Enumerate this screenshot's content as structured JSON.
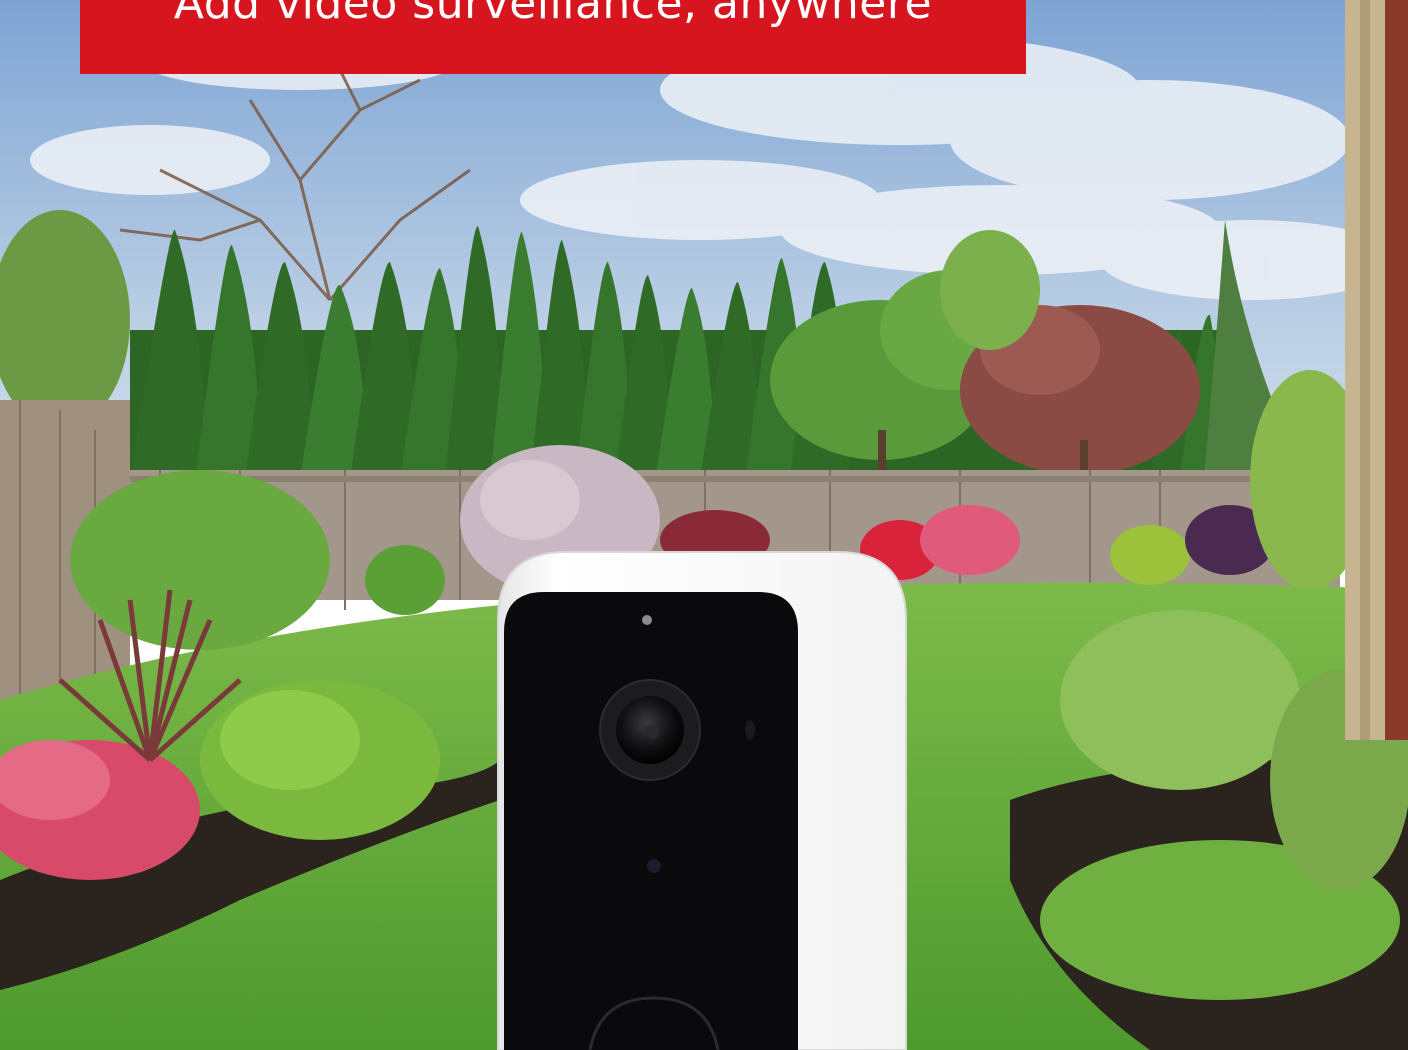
{
  "banner": {
    "text": "Add video surveillance, anywhere",
    "color": "#d7151f"
  },
  "scene": {
    "subject": "camera-icon",
    "colors": {
      "sky": "#a9c4e2",
      "lawn": "#5da83a",
      "hedge": "#2f6a26",
      "fence": "#9c8f7c",
      "camera_body": "#ffffff",
      "camera_face": "#0a0a0c"
    }
  }
}
